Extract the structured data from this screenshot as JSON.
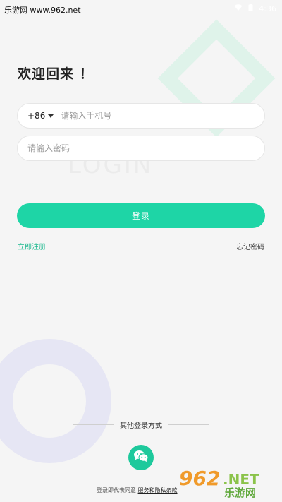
{
  "watermark": {
    "top_text": "乐游网 www.962.net",
    "bottom_number": "962",
    "bottom_suffix": ".NET",
    "bottom_cn": "乐游网"
  },
  "status_bar": {
    "time": "4:36"
  },
  "background_text": "LOGIN",
  "welcome": "欢迎回来 ！",
  "phone_field": {
    "country_code": "+86",
    "placeholder": "请输入手机号"
  },
  "password_field": {
    "placeholder": "请输入密码"
  },
  "login_button": "登录",
  "register_link": "立即注册",
  "forgot_link": "忘记密码",
  "other_login": "其他登录方式",
  "agreement": {
    "prefix": "登录即代表同意",
    "link": "服务和隐私条款"
  },
  "colors": {
    "accent": "#1ed5a6",
    "link_green": "#1db98f",
    "background": "#f5f5f5"
  },
  "icons": [
    "wifi-icon",
    "battery-icon",
    "wechat-icon",
    "chevron-down-icon"
  ]
}
